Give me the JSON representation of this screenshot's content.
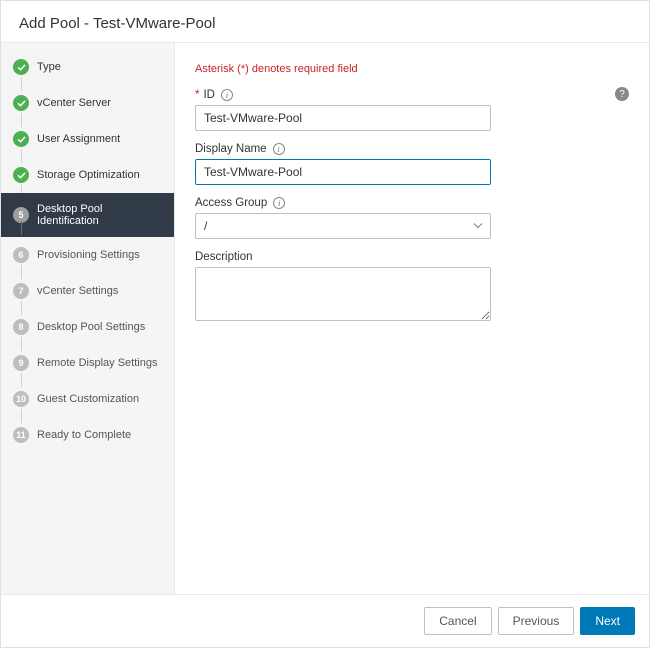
{
  "header": {
    "title": "Add Pool - Test-VMware-Pool"
  },
  "sidebar": {
    "steps": [
      {
        "num": "1",
        "label": "Type",
        "state": "completed"
      },
      {
        "num": "2",
        "label": "vCenter Server",
        "state": "completed"
      },
      {
        "num": "3",
        "label": "User Assignment",
        "state": "completed"
      },
      {
        "num": "4",
        "label": "Storage Optimization",
        "state": "completed"
      },
      {
        "num": "5",
        "label": "Desktop Pool Identification",
        "state": "current"
      },
      {
        "num": "6",
        "label": "Provisioning Settings",
        "state": "upcoming"
      },
      {
        "num": "7",
        "label": "vCenter Settings",
        "state": "upcoming"
      },
      {
        "num": "8",
        "label": "Desktop Pool Settings",
        "state": "upcoming"
      },
      {
        "num": "9",
        "label": "Remote Display Settings",
        "state": "upcoming"
      },
      {
        "num": "10",
        "label": "Guest Customization",
        "state": "upcoming"
      },
      {
        "num": "11",
        "label": "Ready to Complete",
        "state": "upcoming"
      }
    ]
  },
  "form": {
    "required_note": "Asterisk (*) denotes required field",
    "id_label": "ID",
    "id_value": "Test-VMware-Pool",
    "display_name_label": "Display Name",
    "display_name_value": "Test-VMware-Pool",
    "access_group_label": "Access Group",
    "access_group_value": "/",
    "description_label": "Description",
    "description_value": ""
  },
  "footer": {
    "cancel": "Cancel",
    "previous": "Previous",
    "next": "Next"
  },
  "help_glyph": "?"
}
